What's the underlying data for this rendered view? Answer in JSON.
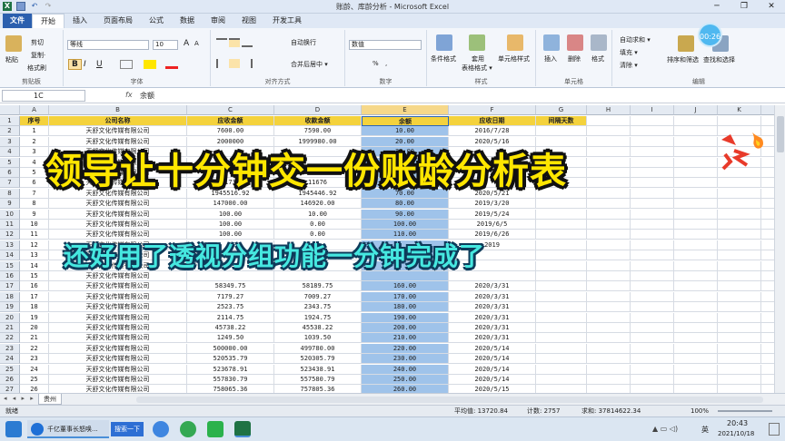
{
  "window": {
    "title": "账龄、库龄分析 - Microsoft Excel"
  },
  "menu": {
    "file": "文件",
    "tabs": [
      "开始",
      "插入",
      "页面布局",
      "公式",
      "数据",
      "审阅",
      "视图",
      "开发工具"
    ]
  },
  "ribbon": {
    "clipboard": {
      "cut": "剪切",
      "copy": "复制·",
      "painter": "格式刷",
      "paste": "粘贴",
      "label": "剪贴板"
    },
    "font": {
      "name": "等线",
      "size": "10",
      "grow": "A",
      "shrink": "A",
      "bold": "B",
      "italic": "I",
      "underline": "U",
      "label": "字体"
    },
    "align": {
      "wrap": "自动换行",
      "merge": "合并后居中 ▾",
      "label": "对齐方式"
    },
    "number": {
      "format": "数值",
      "percent": "%",
      "comma": ",",
      "label": "数字"
    },
    "styles": {
      "cond": "条件格式",
      "table1": "套用",
      "table2": "表格格式 ▾",
      "cell": "单元格样式",
      "label": "样式"
    },
    "cells": {
      "insert": "插入",
      "delete": "删除",
      "format": "格式",
      "label": "单元格"
    },
    "edit": {
      "autosum": "自动求和 ▾",
      "fill": "填充 ▾",
      "clear": "清除 ▾",
      "sort": "排序和筛选",
      "find": "查找和选择",
      "label": "编辑"
    },
    "timer": "00:26"
  },
  "formula": {
    "namebox": "1C",
    "fx": "fx",
    "value": "余额"
  },
  "columns": [
    "A",
    "B",
    "C",
    "D",
    "E",
    "F",
    "G",
    "H",
    "I",
    "J",
    "K",
    "L"
  ],
  "headers": [
    "序号",
    "公司名称",
    "应收金额",
    "收款金额",
    "余额",
    "应收日期",
    "间隔天数"
  ],
  "rows": [
    [
      "1",
      "天舒文化传媒有限公司",
      "7600.00",
      "7590.00",
      "10.00",
      "2016/7/28"
    ],
    [
      "2",
      "天舒文化传媒有限公司",
      "2000000",
      "1999980.00",
      "20.00",
      "2020/5/16"
    ],
    [
      "3",
      "天舒文化传媒有限公司",
      "",
      "",
      "30.00",
      ""
    ],
    [
      "4",
      "天舒文化传媒有限公司",
      "",
      "",
      "40.00",
      ""
    ],
    [
      "5",
      "天舒文化传媒有限公司",
      "",
      "",
      "50.00",
      ""
    ],
    [
      "6",
      "天舒文化传媒有限公司",
      "11736",
      "11676",
      "60.00",
      ""
    ],
    [
      "7",
      "天舒文化传媒有限公司",
      "1945516.92",
      "1945446.92",
      "70.00",
      "2020/5/21"
    ],
    [
      "8",
      "天舒文化传媒有限公司",
      "147000.00",
      "146920.00",
      "80.00",
      "2019/3/20"
    ],
    [
      "9",
      "天舒文化传媒有限公司",
      "100.00",
      "10.00",
      "90.00",
      "2019/5/24"
    ],
    [
      "10",
      "天舒文化传媒有限公司",
      "100.00",
      "0.00",
      "100.00",
      "2019/6/5"
    ],
    [
      "11",
      "天舒文化传媒有限公司",
      "100.00",
      "0.00",
      "110.00",
      "2019/6/26"
    ],
    [
      "12",
      "天舒文化传媒有限公司",
      "",
      "",
      "",
      "2019"
    ],
    [
      "13",
      "天舒文化传媒有限公司",
      "",
      "",
      "",
      ""
    ],
    [
      "14",
      "天舒文化传媒有限公司",
      "",
      "",
      "",
      ""
    ],
    [
      "15",
      "天舒文化传媒有限公司",
      "",
      "",
      "",
      ""
    ],
    [
      "16",
      "天舒文化传媒有限公司",
      "58349.75",
      "58189.75",
      "160.00",
      "2020/3/31"
    ],
    [
      "17",
      "天舒文化传媒有限公司",
      "7179.27",
      "7009.27",
      "170.00",
      "2020/3/31"
    ],
    [
      "18",
      "天舒文化传媒有限公司",
      "2523.75",
      "2343.75",
      "180.00",
      "2020/3/31"
    ],
    [
      "19",
      "天舒文化传媒有限公司",
      "2114.75",
      "1924.75",
      "190.00",
      "2020/3/31"
    ],
    [
      "20",
      "天舒文化传媒有限公司",
      "45738.22",
      "45538.22",
      "200.00",
      "2020/3/31"
    ],
    [
      "21",
      "天舒文化传媒有限公司",
      "1249.50",
      "1039.50",
      "210.00",
      "2020/3/31"
    ],
    [
      "22",
      "天舒文化传媒有限公司",
      "500000.00",
      "499780.00",
      "220.00",
      "2020/5/14"
    ],
    [
      "23",
      "天舒文化传媒有限公司",
      "520535.79",
      "520305.79",
      "230.00",
      "2020/5/14"
    ],
    [
      "24",
      "天舒文化传媒有限公司",
      "523678.91",
      "523438.91",
      "240.00",
      "2020/5/14"
    ],
    [
      "25",
      "天舒文化传媒有限公司",
      "557830.79",
      "557580.79",
      "250.00",
      "2020/5/14"
    ],
    [
      "26",
      "天舒文化传媒有限公司",
      "758065.36",
      "757805.36",
      "260.00",
      "2020/5/15"
    ]
  ],
  "sheet": {
    "nav": "◂ ◂ ▸ ▸",
    "tab": "贵州"
  },
  "status": {
    "ready": "就绪",
    "avg": "平均值: 13720.84",
    "count": "计数: 2757",
    "sum": "求和: 37814622.34",
    "zoom": "100%"
  },
  "overlay": {
    "title": "领导让十分钟交一份账龄分析表",
    "subtitle": "还好用了透视分组功能一分钟完成了"
  },
  "taskbar": {
    "app1": "千亿董事长怒唤...",
    "search": "搜索一下",
    "time": "20:43",
    "date": "2021/10/18",
    "ime": "英"
  },
  "colors": {
    "header_fill": "#f4d23c",
    "balance_fill": "#9fc3ea",
    "overlay_title": "#ffe600",
    "overlay_sub": "#46e8e0"
  }
}
